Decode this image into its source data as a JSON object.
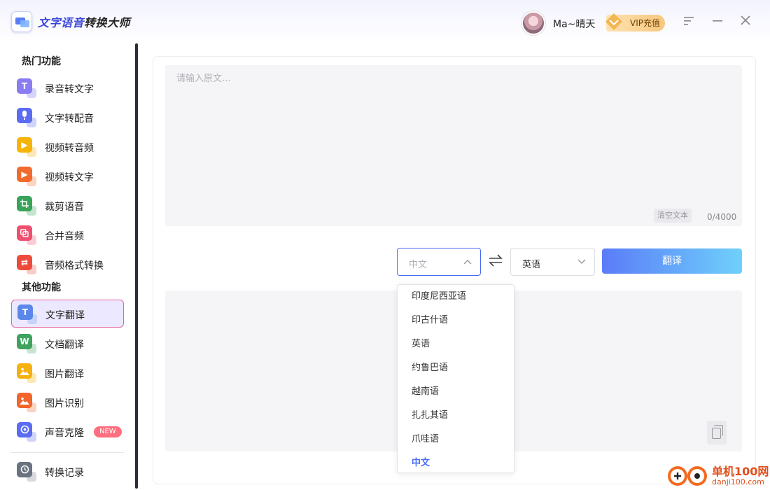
{
  "titlebar": {
    "app_title_part1": "文字语音",
    "app_title_part2": "转换大师",
    "username": "Ma~晴天",
    "vip_label": "VIP充值",
    "menu_icon": "menu-icon",
    "minimize_icon": "minimize-icon",
    "close_icon": "close-icon"
  },
  "sidebar": {
    "hot_section": "热门功能",
    "other_section": "其他功能",
    "hot_items": [
      {
        "label": "录音转文字",
        "icon": "T",
        "color": "#8a7cf3",
        "sub": "#b6b0f7"
      },
      {
        "label": "文字转配音",
        "icon": "🎙",
        "color": "#5b6cf0",
        "sub": "#a8b1f7"
      },
      {
        "label": "视频转音频",
        "icon": "▶",
        "color": "#f5b40a",
        "sub": "#f8d67a"
      },
      {
        "label": "视频转文字",
        "icon": "▶",
        "color": "#f26a2e",
        "sub": "#f7b08f"
      },
      {
        "label": "裁剪语音",
        "icon": "⌗",
        "color": "#3aa35a",
        "sub": "#95d0a8"
      },
      {
        "label": "合并音频",
        "icon": "⧉",
        "color": "#ef4f6f",
        "sub": "#f6a4b5"
      },
      {
        "label": "音频格式转换",
        "icon": "⇄",
        "color": "#ee4b3c",
        "sub": "#f5a39a"
      }
    ],
    "other_items": [
      {
        "label": "文字翻译",
        "icon": "T",
        "color": "#5b87ea",
        "sub": "#a9c1f3",
        "active": true
      },
      {
        "label": "文档翻译",
        "icon": "W",
        "color": "#3fa35f",
        "sub": "#9ccfab"
      },
      {
        "label": "图片翻译",
        "icon": "▣",
        "color": "#f4b10f",
        "sub": "#f8d574"
      },
      {
        "label": "图片识别",
        "icon": "▣",
        "color": "#f2652b",
        "sub": "#f6ae8e"
      },
      {
        "label": "声音克隆",
        "icon": "⟳",
        "color": "#5b6cf0",
        "sub": "#a9b2f7",
        "badge": "NEW"
      }
    ],
    "history_label": "转换记录",
    "history_icon": "history-icon"
  },
  "translator": {
    "source_placeholder": "请输入原文...",
    "clear_label": "清空文本",
    "char_count": "0/4000",
    "source_language": "中文",
    "target_language": "英语",
    "swap_icon": "swap-icon",
    "translate_label": "翻译",
    "copy_icon": "copy-icon"
  },
  "dropdown": {
    "options": [
      "印度尼西亚语",
      "印古什语",
      "英语",
      "约鲁巴语",
      "越南语",
      "扎扎其语",
      "爪哇语",
      "中文"
    ],
    "selected": "中文"
  },
  "watermark": {
    "text1": "单机100网",
    "text2": "danji100.com"
  },
  "colors": {
    "accent": "#4a6cf5",
    "active_border": "#e5659a",
    "active_bg": "#ece8ff",
    "vip_gold": "#f6c77e",
    "new_badge": "#ff6f7f"
  }
}
